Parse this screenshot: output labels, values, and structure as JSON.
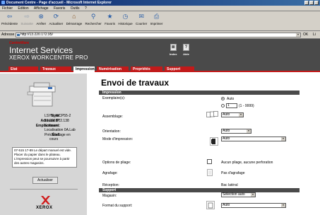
{
  "window": {
    "title": "Document Centre - Page d'accueil - Microsoft Internet Explorer"
  },
  "menu": [
    "Fichier",
    "Edition",
    "Affichage",
    "Favoris",
    "Outils",
    "?"
  ],
  "toolbar": {
    "back": "Précédente",
    "forward": "Suivante",
    "stop": "Arrêter",
    "refresh": "Actualiser",
    "home": "Démarrage",
    "search": "Rechercher",
    "favorites": "Favoris",
    "history": "Historique",
    "mail": "Courrier",
    "print": "Imprimer"
  },
  "address": {
    "label": "Adresse",
    "url": "http://13.220.172.95/",
    "go": "OK",
    "links": "Li"
  },
  "brand": {
    "cw": "CentreWare",
    "title": "Internet Services",
    "model": "XEROX WORKCENTRE PRO",
    "index": "Index",
    "help": "Aide"
  },
  "tabs": [
    "Etat",
    "Travaux",
    "Impression",
    "Numérisation",
    "Propriétés",
    "Support"
  ],
  "active_tab": "Impression",
  "sidebar": {
    "name_label": "Nom:",
    "name_value": "LSYS_WCP55-2",
    "ip_label": "Adresse IP:",
    "ip_value": "13.220.172.138",
    "loc_label": "Emplacement:",
    "loc_value1": "Software",
    "loc_value2": "Localisation 0A.Lab",
    "state_label": "État:",
    "state_value1": "Préchauffage en",
    "state_value2": "cours",
    "message": "07-515 17-89 Le départ manuel est vide. Placer du papier dans le plateau. L'impression peut se poursuivre à partir des autres magasins.",
    "refresh_button": "Actualiser",
    "logo_text": "XEROX"
  },
  "content": {
    "title": "Envoi de travaux",
    "section1": "Impression",
    "copies_label": "Exemplaire(s):",
    "copies_auto": "Auto",
    "copies_value": "1",
    "copies_range": "(1 - 9999)",
    "collation_label": "Assemblage:",
    "collation_value": "Auto",
    "orientation_label": "Orientation:",
    "orientation_value": "Auto",
    "mode_label": "Mode d'impression:",
    "mode_value": "Auto",
    "folding_label": "Options de pliage:",
    "folding_value": "Aucun pliage, aucune perforation",
    "stapling_label": "Agrafage:",
    "stapling_value": "Pas d'agrafage",
    "receipt_label": "Réception:",
    "receipt_value": "Bac latéral",
    "section2": "Support",
    "tray_label": "Magasin:",
    "tray_value": "Sélection auto",
    "format_label": "Format du support:",
    "format_value": "Auto"
  }
}
